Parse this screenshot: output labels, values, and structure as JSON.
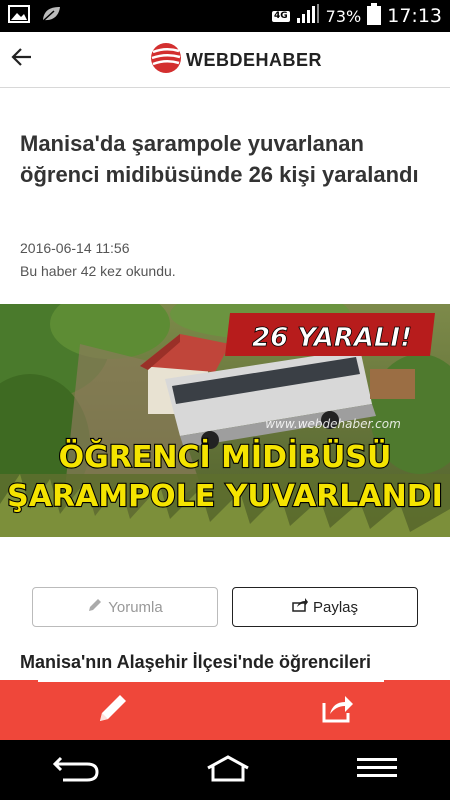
{
  "status_bar": {
    "network_badge": "4G",
    "battery": "73%",
    "time": "17:13",
    "icons": [
      "image-notification-icon",
      "leaf-notification-icon",
      "signal-icon",
      "battery-icon"
    ]
  },
  "header": {
    "logo_text": "WEBDEHABER",
    "back_icon": "arrow-left-icon",
    "brand_color": "#e53935"
  },
  "article": {
    "title": "Manisa'da şarampole yuvarlanan öğrenci midibüsünde 26 kişi yaralandı",
    "date": "2016-06-14 11:56",
    "views": "Bu haber 42 kez okundu.",
    "image": {
      "badge": "26 YARALI!",
      "watermark": "www.webdehaber.com",
      "headline_line1": "ÖĞRENCİ MİDİBÜSÜ",
      "headline_line2": "ŞARAMPOLE YUVARLANDI"
    },
    "lead": "Manisa'nın Alaşehir İlçesi'nde öğrencileri"
  },
  "buttons": {
    "comment_label": "Yorumla",
    "share_label": "Paylaş"
  },
  "action_bar": {
    "color": "#ef473a",
    "items": [
      "pencil-icon",
      "share-icon"
    ]
  },
  "nav_bar": {
    "items": [
      "back-nav-icon",
      "home-nav-icon",
      "menu-nav-icon"
    ]
  }
}
